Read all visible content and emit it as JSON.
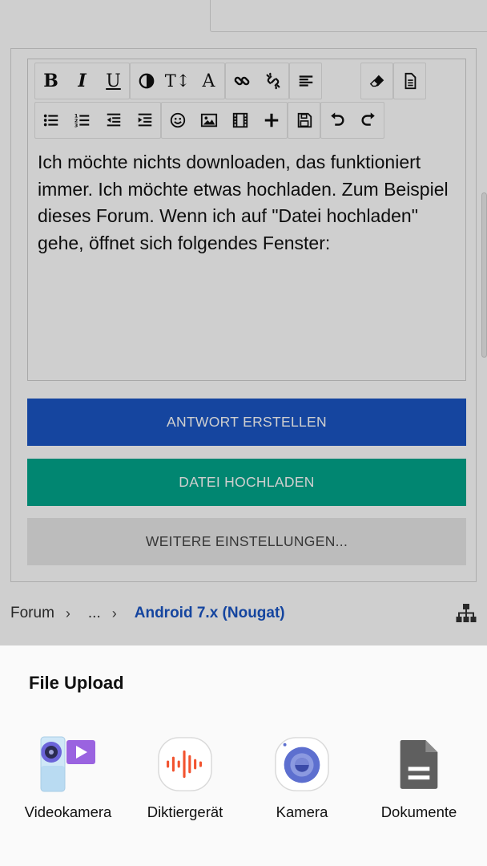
{
  "toolbar": {
    "row1": [
      "bold-icon",
      "italic-icon",
      "underline-icon",
      "contrast-icon",
      "text-size-icon",
      "font-icon",
      "link-icon",
      "unlink-icon",
      "align-icon",
      "eraser-icon",
      "source-icon"
    ],
    "row2": [
      "bulleted-list-icon",
      "numbered-list-icon",
      "outdent-icon",
      "indent-icon",
      "emoji-icon",
      "image-icon",
      "video-icon",
      "plus-icon",
      "save-icon",
      "undo-icon",
      "redo-icon"
    ],
    "bold_glyph": "B",
    "italic_glyph": "I",
    "underline_glyph": "U",
    "font_glyph": "A",
    "text_size_glyph": "T↕"
  },
  "editor": {
    "text": "Ich möchte nichts downloaden, das funktioniert immer. Ich möchte etwas hochladen. Zum Beispiel dieses Forum. Wenn ich auf \"Datei hochladen\" gehe, öffnet sich folgendes Fenster:"
  },
  "buttons": {
    "answer": "ANTWORT ERSTELLEN",
    "upload": "DATEI HOCHLADEN",
    "more": "WEITERE EINSTELLUNGEN..."
  },
  "breadcrumb": {
    "items": [
      "Forum",
      "...",
      "Android 7.x (Nougat)"
    ],
    "separator": "›"
  },
  "sheet": {
    "title": "File Upload",
    "apps": [
      {
        "label": "Videokamera",
        "icon": "video-camera-app-icon"
      },
      {
        "label": "Diktiergerät",
        "icon": "voice-recorder-app-icon"
      },
      {
        "label": "Kamera",
        "icon": "camera-app-icon"
      },
      {
        "label": "Dokumente",
        "icon": "documents-app-icon"
      }
    ]
  },
  "colors": {
    "answer_button": "#1a56c4",
    "upload_button": "#02a58c",
    "more_button": "#e8e8e8",
    "breadcrumb_current": "#1a56c4"
  }
}
